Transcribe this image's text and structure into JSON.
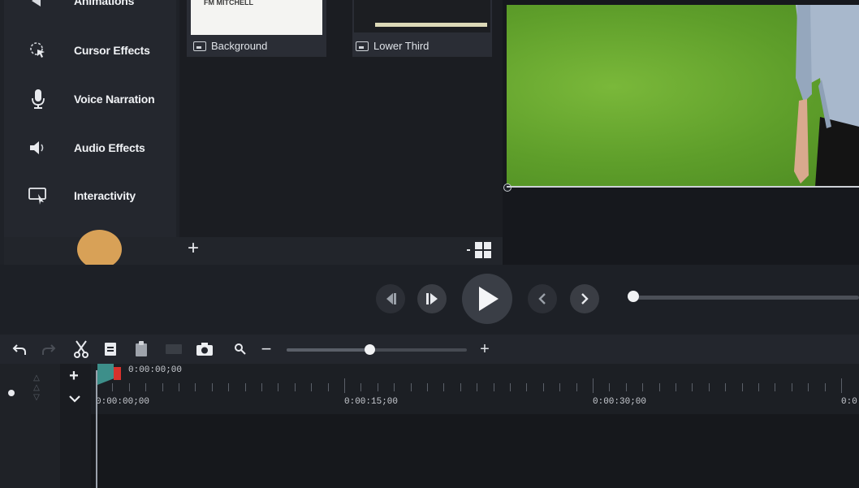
{
  "sidebar": {
    "items": [
      {
        "label": "Animations",
        "icon": "animations-icon"
      },
      {
        "label": "Cursor Effects",
        "icon": "cursor-effects-icon"
      },
      {
        "label": "Voice Narration",
        "icon": "microphone-icon"
      },
      {
        "label": "Audio Effects",
        "icon": "speaker-icon"
      },
      {
        "label": "Interactivity",
        "icon": "interactivity-icon"
      }
    ]
  },
  "media_bin": {
    "items": [
      {
        "label": "Background",
        "preview_text": "FM MITCHELL"
      },
      {
        "label": "Lower Third"
      }
    ],
    "add_symbol": "+"
  },
  "timeline": {
    "playhead_time": "0:00:00;00",
    "ruler_labels": [
      "0:00:00;00",
      "0:00:15;00",
      "0:00:30;00",
      "0:0"
    ],
    "zoom_level": 0.46,
    "zoom_minus": "−",
    "zoom_plus": "+",
    "add_track_symbol": "+"
  },
  "playback": {
    "scrub_position": 0.0
  },
  "colors": {
    "accent_teal": "#3d8f8a",
    "playhead_red": "#d8322c",
    "green_screen": "#6aaa30",
    "record_circle": "#e3a85a"
  }
}
